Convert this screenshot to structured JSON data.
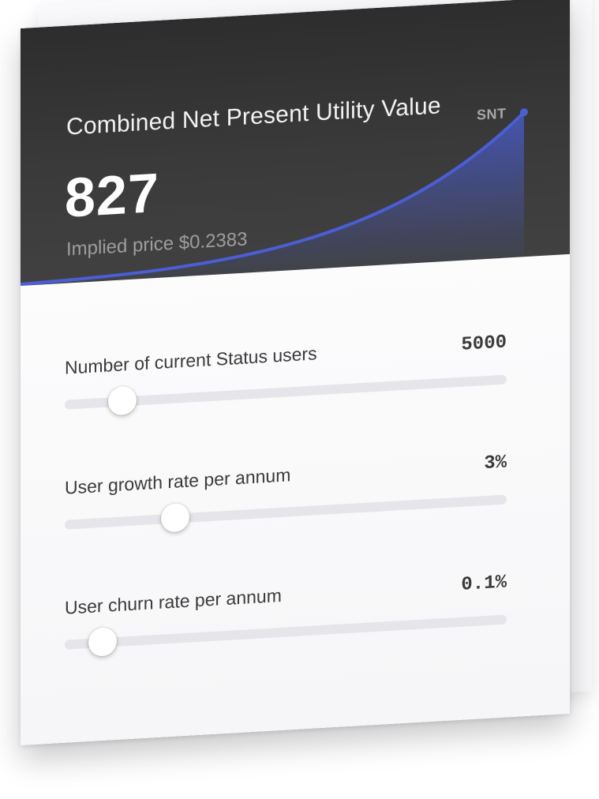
{
  "card": {
    "title": "Combined Net Present Utility Value",
    "value": "827",
    "implied_price": "Implied price $0.2383",
    "unit": "SNT",
    "accent_color": "#4a5fd6",
    "header_color": "#333333"
  },
  "sliders": [
    {
      "label": "Number of current Status users",
      "value": "5000",
      "position_fraction": 0.13
    },
    {
      "label": "User growth rate per annum",
      "value": "3%",
      "position_fraction": 0.25
    },
    {
      "label": "User churn rate per annum",
      "value": "0.1%",
      "position_fraction": 0.085
    }
  ]
}
